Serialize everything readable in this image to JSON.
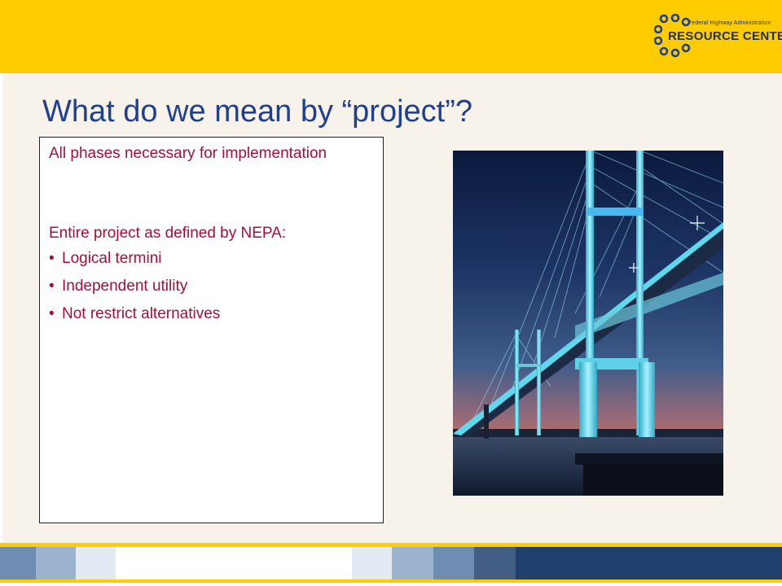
{
  "logo": {
    "small_text": "Federal Highway Administration",
    "main_text": "RESOURCE CENTER"
  },
  "slide": {
    "title": "What do we mean by “project”?",
    "paragraph1": "All phases necessary for implementation",
    "paragraph2": "Entire project as defined by NEPA:",
    "bullets": [
      "Logical termini",
      "Independent utility",
      "Not restrict alternatives"
    ]
  },
  "colors": {
    "banner": "#FFCC00",
    "title": "#1F3F91",
    "body_text": "#A50F3A",
    "slide_background": "#F7F3EA",
    "footer_dark": "#1F3F6E"
  },
  "icons": {
    "logo_ring": "circle-ring-icon",
    "bullet": "bullet-dot-icon"
  },
  "image": {
    "subject": "cable-stayed bridge at dusk"
  }
}
